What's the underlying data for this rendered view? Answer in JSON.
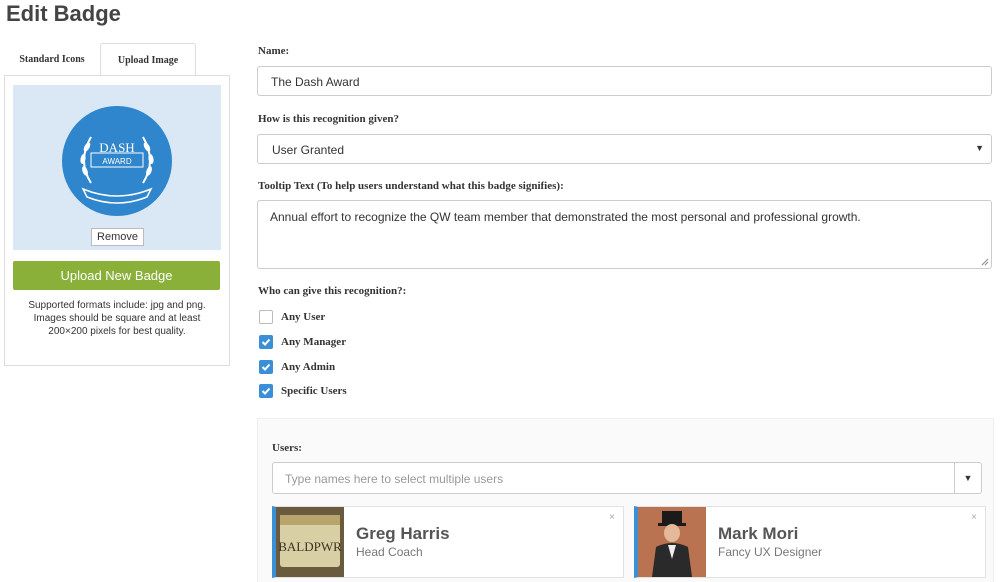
{
  "page": {
    "title": "Edit Badge"
  },
  "left_panel": {
    "tabs": [
      "Standard Icons",
      "Upload Image"
    ],
    "active_tab": "Upload Image",
    "badge_image": {
      "top_text": "DASH",
      "bottom_text": "AWARD"
    },
    "remove_label": "Remove",
    "upload_label": "Upload New Badge",
    "formats_text": "Supported formats include: jpg and png. Images should be square and at least 200×200 pixels for best quality."
  },
  "form": {
    "name_label": "Name:",
    "name_value": "The Dash Award",
    "given_label": "How is this recognition given?",
    "given_value": "User Granted",
    "tooltip_label": "Tooltip Text (To help users understand what this badge signifies):",
    "tooltip_value": "Annual effort to recognize the QW team member that demonstrated the most personal and professional growth.",
    "who_label": "Who can give this recognition?:",
    "options": [
      {
        "label": "Any User",
        "checked": false
      },
      {
        "label": "Any Manager",
        "checked": true
      },
      {
        "label": "Any Admin",
        "checked": true
      },
      {
        "label": "Specific Users",
        "checked": true
      }
    ]
  },
  "users": {
    "label": "Users:",
    "placeholder": "Type names here to select multiple users",
    "selected": [
      {
        "name": "Greg Harris",
        "role": "Head Coach",
        "photo_text": "BALDPWR"
      },
      {
        "name": "Mark Mori",
        "role": "Fancy UX Designer"
      }
    ],
    "remove_glyph": "×"
  },
  "colors": {
    "accent": "#3a8fd6",
    "upload_button": "#8bb03a",
    "badge_blue": "#2f86cc",
    "preview_bg": "#dae8f5"
  }
}
